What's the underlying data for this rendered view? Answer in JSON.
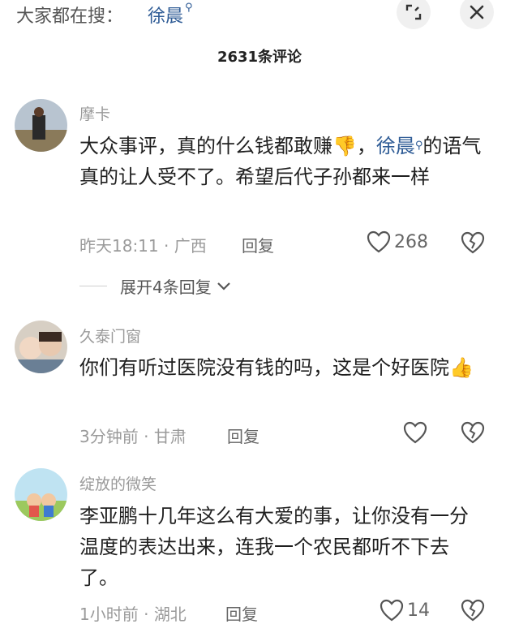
{
  "header": {
    "search_prefix": "大家都在搜：",
    "search_term": "徐晨",
    "comment_count": "2631条评论"
  },
  "comments": [
    {
      "user": "摩卡",
      "text_before": "大众事评，真的什么钱都敢赚",
      "emoji": "👎",
      "text_mid": "，",
      "mention": "徐晨",
      "text_after": "的语气真的让人受不了。希望后代子孙都来一样",
      "time": "昨天18:11",
      "location": "广西",
      "reply_label": "回复",
      "likes": "268",
      "expand_label": "展开4条回复"
    },
    {
      "user": "久泰门窗",
      "text_before": "你们有听过医院没有钱的吗，这是个好医院",
      "emoji": "👍",
      "time": "3分钟前",
      "location": "甘肃",
      "reply_label": "回复",
      "likes": ""
    },
    {
      "user": "绽放的微笑",
      "text_before": "李亚鹏十几年这么有大爱的事，让你没有一分温度的表达出来，连我一个农民都听不下去了。",
      "time": "1小时前",
      "location": "湖北",
      "reply_label": "回复",
      "likes": "14"
    }
  ],
  "icons": {
    "search_hint": "search-icon",
    "collapse": "collapse-icon",
    "close": "close-icon",
    "like": "heart-icon",
    "dislike": "broken-heart-icon",
    "chevron": "chevron-down-icon"
  },
  "colors": {
    "mention": "#2f5c96",
    "meta": "#9a9a9a"
  }
}
